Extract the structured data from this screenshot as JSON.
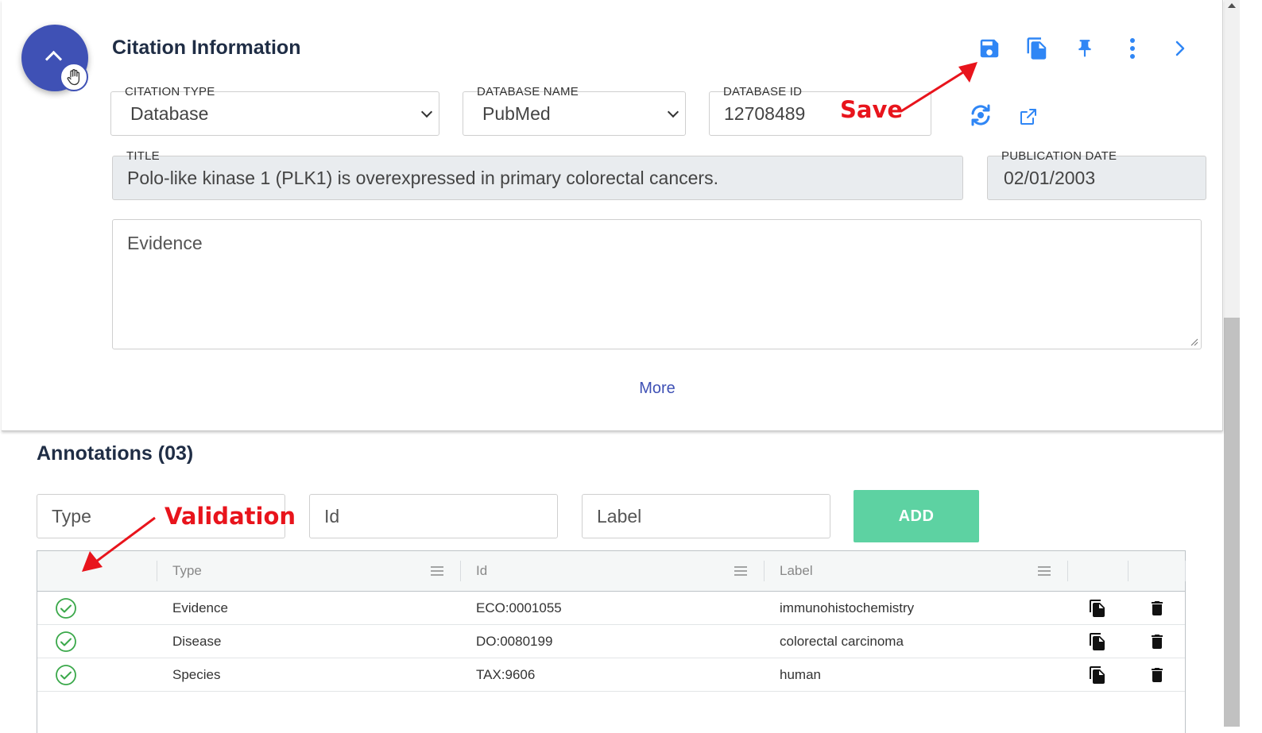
{
  "card": {
    "title": "Citation Information",
    "citation_type_label": "CITATION TYPE",
    "citation_type_value": "Database",
    "database_name_label": "DATABASE NAME",
    "database_name_value": "PubMed",
    "database_id_label": "DATABASE ID",
    "database_id_value": "12708489",
    "title_label": "TITLE",
    "title_value": "Polo-like kinase 1 (PLK1) is overexpressed in primary colorectal cancers.",
    "pub_date_label": "PUBLICATION DATE",
    "pub_date_value": "02/01/2003",
    "evidence_placeholder": "Evidence",
    "more_label": "More"
  },
  "toolbar_icons": [
    "save-icon",
    "copy-icon",
    "pin-icon",
    "more-vert-icon",
    "chevron-right-icon"
  ],
  "annotations": {
    "title": "Annotations (03)",
    "type_placeholder": "Type",
    "id_placeholder": "Id",
    "label_placeholder": "Label",
    "add_label": "ADD",
    "columns": [
      "Type",
      "Id",
      "Label"
    ],
    "rows": [
      {
        "type": "Evidence",
        "id": "ECO:0001055",
        "label": "immunohistochemistry"
      },
      {
        "type": "Disease",
        "id": "DO:0080199",
        "label": "colorectal carcinoma"
      },
      {
        "type": "Species",
        "id": "TAX:9606",
        "label": "human"
      }
    ]
  },
  "callouts": {
    "save": "Save",
    "validation": "Validation"
  },
  "colors": {
    "primary": "#3f51b5",
    "icon_blue": "#2f86f5",
    "add_button": "#5dd2a2",
    "valid_green": "#3aa84a",
    "callout_red": "#e8141c"
  }
}
